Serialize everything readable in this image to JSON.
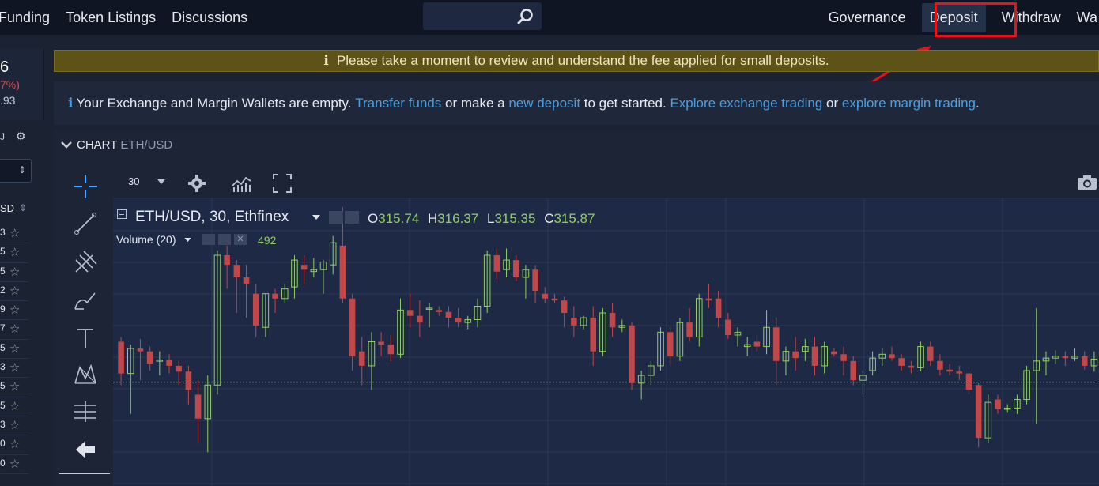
{
  "topnav": {
    "left_links": [
      "Funding",
      "Token Listings",
      "Discussions"
    ],
    "governance": "Governance",
    "deposit": "Deposit",
    "withdraw": "Withdraw",
    "truncated": "Wa"
  },
  "left_panel": {
    "price": "6",
    "change": "7%)",
    "volume": ".93",
    "sort_label": "SD",
    "row_values": [
      "3",
      "5",
      "5",
      "2",
      "9",
      "7",
      "5",
      "3",
      "5",
      "5",
      "3",
      "0",
      "0"
    ]
  },
  "fee_banner": {
    "text": "Please take a moment to review and understand the fee applied for small deposits."
  },
  "wallet_banner": {
    "text1": "Your Exchange and Margin Wallets are empty.",
    "link1": "Transfer funds",
    "text2": "or make a",
    "link2": "new deposit",
    "text3": "to get started.",
    "link3": "Explore exchange trading",
    "text4": "or",
    "link4": "explore margin trading",
    "text5": "."
  },
  "chart": {
    "header_title": "CHART",
    "header_pair": "ETH/USD",
    "interval": "30",
    "symbol_label": "ETH/USD, 30, Ethfinex",
    "ohlc": {
      "o_label": "O",
      "o": "315.74",
      "h_label": "H",
      "h": "316.37",
      "l_label": "L",
      "l": "315.35",
      "c_label": "C",
      "c": "315.87"
    },
    "volume_label": "Volume (20)",
    "volume_value": "492",
    "colors": {
      "up": "#8fcf5f",
      "down": "#c0474a",
      "bg": "#1e2a45",
      "grid": "#2a3654"
    }
  },
  "chart_data": {
    "type": "candlestick",
    "candles": [
      {
        "o": 316.05,
        "h": 316.1,
        "l": 315.6,
        "c": 315.72
      },
      {
        "o": 315.72,
        "h": 316.02,
        "l": 315.3,
        "c": 315.98
      },
      {
        "o": 315.98,
        "h": 316.08,
        "l": 315.65,
        "c": 315.95
      },
      {
        "o": 315.95,
        "h": 316.0,
        "l": 315.75,
        "c": 315.82
      },
      {
        "o": 315.85,
        "h": 315.95,
        "l": 315.7,
        "c": 315.86
      },
      {
        "o": 315.86,
        "h": 315.92,
        "l": 315.72,
        "c": 315.8
      },
      {
        "o": 315.8,
        "h": 315.85,
        "l": 315.6,
        "c": 315.74
      },
      {
        "o": 315.74,
        "h": 315.8,
        "l": 315.4,
        "c": 315.55
      },
      {
        "o": 315.5,
        "h": 315.65,
        "l": 315.0,
        "c": 315.25
      },
      {
        "o": 315.25,
        "h": 315.7,
        "l": 314.9,
        "c": 315.6
      },
      {
        "o": 315.6,
        "h": 317.0,
        "l": 315.5,
        "c": 316.95
      },
      {
        "o": 316.95,
        "h": 317.05,
        "l": 316.6,
        "c": 316.85
      },
      {
        "o": 316.85,
        "h": 316.9,
        "l": 316.35,
        "c": 316.72
      },
      {
        "o": 316.72,
        "h": 316.85,
        "l": 316.3,
        "c": 316.65
      },
      {
        "o": 316.55,
        "h": 316.65,
        "l": 316.1,
        "c": 316.22
      },
      {
        "o": 316.2,
        "h": 316.55,
        "l": 316.1,
        "c": 316.55
      },
      {
        "o": 316.55,
        "h": 316.6,
        "l": 316.35,
        "c": 316.5
      },
      {
        "o": 316.5,
        "h": 316.65,
        "l": 316.45,
        "c": 316.6
      },
      {
        "o": 316.62,
        "h": 316.95,
        "l": 316.5,
        "c": 316.9
      },
      {
        "o": 316.85,
        "h": 316.95,
        "l": 316.65,
        "c": 316.8
      },
      {
        "o": 316.78,
        "h": 316.92,
        "l": 316.72,
        "c": 316.8
      },
      {
        "o": 316.8,
        "h": 316.9,
        "l": 316.55,
        "c": 316.88
      },
      {
        "o": 316.85,
        "h": 317.15,
        "l": 316.75,
        "c": 317.08
      },
      {
        "o": 317.05,
        "h": 317.45,
        "l": 316.45,
        "c": 316.5
      },
      {
        "o": 316.5,
        "h": 316.55,
        "l": 315.75,
        "c": 315.9
      },
      {
        "o": 315.95,
        "h": 316.1,
        "l": 315.6,
        "c": 315.8
      },
      {
        "o": 315.8,
        "h": 316.15,
        "l": 315.55,
        "c": 316.05
      },
      {
        "o": 316.05,
        "h": 316.15,
        "l": 315.9,
        "c": 316.02
      },
      {
        "o": 316.02,
        "h": 316.12,
        "l": 315.85,
        "c": 315.92
      },
      {
        "o": 315.92,
        "h": 316.5,
        "l": 315.88,
        "c": 316.38
      },
      {
        "o": 316.38,
        "h": 316.55,
        "l": 316.2,
        "c": 316.32
      },
      {
        "o": 316.32,
        "h": 316.48,
        "l": 316.1,
        "c": 316.25
      },
      {
        "o": 316.4,
        "h": 316.45,
        "l": 316.2,
        "c": 316.4
      },
      {
        "o": 316.38,
        "h": 316.42,
        "l": 316.32,
        "c": 316.36
      },
      {
        "o": 316.36,
        "h": 316.42,
        "l": 316.2,
        "c": 316.3
      },
      {
        "o": 316.3,
        "h": 316.4,
        "l": 316.2,
        "c": 316.25
      },
      {
        "o": 316.25,
        "h": 316.32,
        "l": 316.18,
        "c": 316.28
      },
      {
        "o": 316.28,
        "h": 316.5,
        "l": 316.2,
        "c": 316.42
      },
      {
        "o": 316.42,
        "h": 317.0,
        "l": 316.35,
        "c": 316.95
      },
      {
        "o": 316.95,
        "h": 317.02,
        "l": 316.7,
        "c": 316.78
      },
      {
        "o": 316.8,
        "h": 317.02,
        "l": 316.72,
        "c": 316.9
      },
      {
        "o": 316.9,
        "h": 316.95,
        "l": 316.68,
        "c": 316.72
      },
      {
        "o": 316.72,
        "h": 316.85,
        "l": 316.5,
        "c": 316.8
      },
      {
        "o": 316.8,
        "h": 316.85,
        "l": 316.45,
        "c": 316.58
      },
      {
        "o": 316.55,
        "h": 316.62,
        "l": 316.45,
        "c": 316.5
      },
      {
        "o": 316.5,
        "h": 316.55,
        "l": 316.45,
        "c": 316.48
      },
      {
        "o": 316.48,
        "h": 316.52,
        "l": 316.2,
        "c": 316.35
      },
      {
        "o": 316.3,
        "h": 316.42,
        "l": 316.1,
        "c": 316.22
      },
      {
        "o": 316.22,
        "h": 316.32,
        "l": 316.18,
        "c": 316.3
      },
      {
        "o": 316.3,
        "h": 316.42,
        "l": 315.8,
        "c": 315.95
      },
      {
        "o": 315.95,
        "h": 316.4,
        "l": 315.9,
        "c": 316.35
      },
      {
        "o": 316.35,
        "h": 316.45,
        "l": 316.1,
        "c": 316.2
      },
      {
        "o": 316.2,
        "h": 316.28,
        "l": 316.15,
        "c": 316.22
      },
      {
        "o": 316.22,
        "h": 316.25,
        "l": 315.55,
        "c": 315.62
      },
      {
        "o": 315.62,
        "h": 315.75,
        "l": 315.45,
        "c": 315.7
      },
      {
        "o": 315.7,
        "h": 315.85,
        "l": 315.6,
        "c": 315.8
      },
      {
        "o": 315.8,
        "h": 316.2,
        "l": 315.75,
        "c": 316.15
      },
      {
        "o": 316.15,
        "h": 316.2,
        "l": 315.8,
        "c": 315.9
      },
      {
        "o": 315.9,
        "h": 316.3,
        "l": 315.85,
        "c": 316.25
      },
      {
        "o": 316.25,
        "h": 316.4,
        "l": 316.05,
        "c": 316.1
      },
      {
        "o": 316.1,
        "h": 316.55,
        "l": 316.0,
        "c": 316.5
      },
      {
        "o": 316.5,
        "h": 316.65,
        "l": 316.4,
        "c": 316.48
      },
      {
        "o": 316.5,
        "h": 316.58,
        "l": 316.2,
        "c": 316.3
      },
      {
        "o": 316.28,
        "h": 316.35,
        "l": 316.08,
        "c": 316.12
      },
      {
        "o": 316.12,
        "h": 316.2,
        "l": 316.0,
        "c": 316.15
      },
      {
        "o": 316.0,
        "h": 316.1,
        "l": 315.9,
        "c": 316.02
      },
      {
        "o": 316.05,
        "h": 316.12,
        "l": 315.95,
        "c": 316.0
      },
      {
        "o": 316.0,
        "h": 316.38,
        "l": 315.92,
        "c": 316.2
      },
      {
        "o": 316.2,
        "h": 316.3,
        "l": 315.6,
        "c": 315.85
      },
      {
        "o": 315.85,
        "h": 316.0,
        "l": 315.7,
        "c": 315.95
      },
      {
        "o": 315.95,
        "h": 316.1,
        "l": 315.75,
        "c": 315.88
      },
      {
        "o": 315.95,
        "h": 316.08,
        "l": 315.85,
        "c": 316.0
      },
      {
        "o": 316.0,
        "h": 316.1,
        "l": 315.7,
        "c": 315.8
      },
      {
        "o": 315.8,
        "h": 316.05,
        "l": 315.72,
        "c": 316.0
      },
      {
        "o": 315.95,
        "h": 315.98,
        "l": 315.9,
        "c": 315.92
      },
      {
        "o": 315.92,
        "h": 316.0,
        "l": 315.7,
        "c": 315.85
      },
      {
        "o": 315.85,
        "h": 315.9,
        "l": 315.6,
        "c": 315.65
      },
      {
        "o": 315.65,
        "h": 315.75,
        "l": 315.5,
        "c": 315.7
      },
      {
        "o": 315.75,
        "h": 315.95,
        "l": 315.7,
        "c": 315.88
      },
      {
        "o": 315.88,
        "h": 315.98,
        "l": 315.8,
        "c": 315.92
      },
      {
        "o": 315.92,
        "h": 316.0,
        "l": 315.85,
        "c": 315.88
      },
      {
        "o": 315.88,
        "h": 315.92,
        "l": 315.75,
        "c": 315.8
      },
      {
        "o": 315.8,
        "h": 315.85,
        "l": 315.72,
        "c": 315.78
      },
      {
        "o": 315.78,
        "h": 316.05,
        "l": 315.75,
        "c": 316.0
      },
      {
        "o": 316.0,
        "h": 316.05,
        "l": 315.8,
        "c": 315.85
      },
      {
        "o": 315.85,
        "h": 315.92,
        "l": 315.7,
        "c": 315.76
      },
      {
        "o": 315.76,
        "h": 315.82,
        "l": 315.7,
        "c": 315.74
      },
      {
        "o": 315.74,
        "h": 315.8,
        "l": 315.65,
        "c": 315.72
      },
      {
        "o": 315.72,
        "h": 315.78,
        "l": 315.5,
        "c": 315.55
      },
      {
        "o": 315.6,
        "h": 315.62,
        "l": 314.95,
        "c": 315.05
      },
      {
        "o": 315.05,
        "h": 315.5,
        "l": 315.0,
        "c": 315.42
      },
      {
        "o": 315.45,
        "h": 315.5,
        "l": 315.3,
        "c": 315.35
      },
      {
        "o": 315.35,
        "h": 315.4,
        "l": 315.32,
        "c": 315.36
      },
      {
        "o": 315.36,
        "h": 315.5,
        "l": 315.3,
        "c": 315.45
      },
      {
        "o": 315.45,
        "h": 315.8,
        "l": 315.4,
        "c": 315.75
      },
      {
        "o": 315.75,
        "h": 316.4,
        "l": 315.2,
        "c": 315.85
      },
      {
        "o": 315.85,
        "h": 315.95,
        "l": 315.7,
        "c": 315.88
      },
      {
        "o": 315.88,
        "h": 315.96,
        "l": 315.82,
        "c": 315.9
      },
      {
        "o": 315.9,
        "h": 315.95,
        "l": 315.8,
        "c": 315.88
      },
      {
        "o": 315.88,
        "h": 315.98,
        "l": 315.85,
        "c": 315.9
      },
      {
        "o": 315.9,
        "h": 315.95,
        "l": 315.76,
        "c": 315.8
      },
      {
        "o": 315.8,
        "h": 315.95,
        "l": 315.74,
        "c": 315.87
      }
    ]
  }
}
